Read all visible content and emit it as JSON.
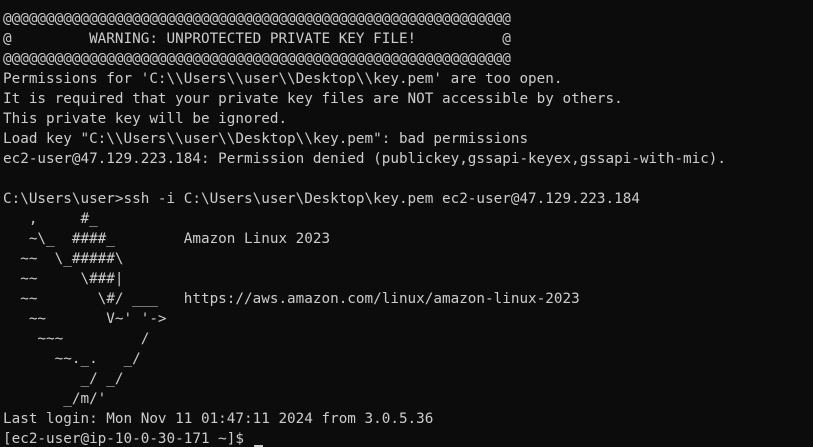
{
  "terminal": {
    "lines": [
      "@@@@@@@@@@@@@@@@@@@@@@@@@@@@@@@@@@@@@@@@@@@@@@@@@@@@@@@@@@@",
      "@         WARNING: UNPROTECTED PRIVATE KEY FILE!          @",
      "@@@@@@@@@@@@@@@@@@@@@@@@@@@@@@@@@@@@@@@@@@@@@@@@@@@@@@@@@@@",
      "Permissions for 'C:\\\\Users\\\\user\\\\Desktop\\\\key.pem' are too open.",
      "It is required that your private key files are NOT accessible by others.",
      "This private key will be ignored.",
      "Load key \"C:\\\\Users\\\\user\\\\Desktop\\\\key.pem\": bad permissions",
      "ec2-user@47.129.223.184: Permission denied (publickey,gssapi-keyex,gssapi-with-mic).",
      "",
      "C:\\Users\\user>ssh -i C:\\Users\\user\\Desktop\\key.pem ec2-user@47.129.223.184",
      "   ,     #_",
      "   ~\\_  ####_        Amazon Linux 2023",
      "  ~~  \\_#####\\",
      "  ~~     \\###|",
      "  ~~       \\#/ ___   https://aws.amazon.com/linux/amazon-linux-2023",
      "   ~~       V~' '->",
      "    ~~~         /",
      "      ~~._.   _/",
      "         _/ _/",
      "       _/m/'",
      "Last login: Mon Nov 11 01:47:11 2024 from 3.0.5.36"
    ],
    "prompt": "[ec2-user@ip-10-0-30-171 ~]$ "
  }
}
